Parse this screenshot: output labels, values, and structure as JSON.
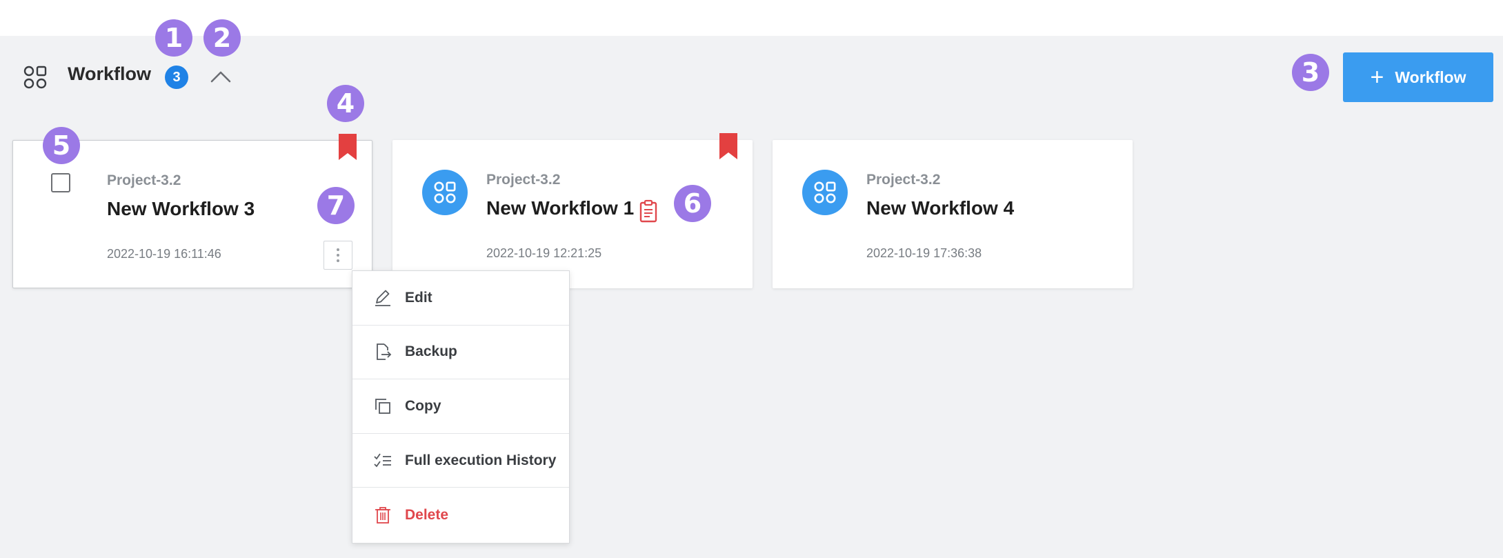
{
  "header": {
    "title": "Workflow",
    "count": "3",
    "icon": "workflow-icon",
    "collapse_icon": "chevron-up-icon"
  },
  "add_button": {
    "plus": "+",
    "label": "Workflow"
  },
  "cards": [
    {
      "project": "Project-3.2",
      "name": "New Workflow 3",
      "date": "2022-10-19 16:11:46",
      "bookmarked": true,
      "selectable": true
    },
    {
      "project": "Project-3.2",
      "name": "New Workflow 1",
      "date": "2022-10-19 12:21:25",
      "bookmarked": true,
      "has_clipboard_icon": true
    },
    {
      "project": "Project-3.2",
      "name": "New Workflow 4",
      "date": "2022-10-19 17:36:38",
      "bookmarked": false
    }
  ],
  "context_menu": {
    "items": [
      {
        "label": "Edit",
        "icon": "pencil-icon"
      },
      {
        "label": "Backup",
        "icon": "file-export-icon"
      },
      {
        "label": "Copy",
        "icon": "copy-icon"
      },
      {
        "label": "Full execution History",
        "icon": "checklist-icon"
      },
      {
        "label": "Delete",
        "icon": "trash-icon"
      }
    ]
  },
  "callouts": [
    "1",
    "2",
    "3",
    "4",
    "5",
    "6",
    "7"
  ],
  "colors": {
    "accent_blue": "#3a9cf0",
    "badge_blue": "#1f82e6",
    "bookmark_red": "#e34040",
    "delete_red": "#e0474c",
    "callout_purple": "#9b79e6",
    "background": "#f1f2f4"
  }
}
